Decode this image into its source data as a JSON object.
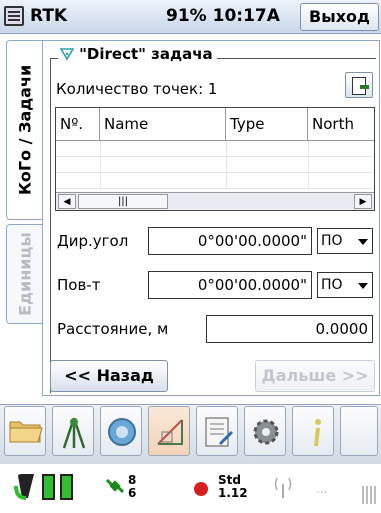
{
  "titlebar": {
    "app_title": "RTK",
    "status": "91% 10:17A",
    "exit_label": "Выход"
  },
  "tabs": [
    {
      "label": "КоГо / Задачи",
      "active": true
    },
    {
      "label": "Единицы",
      "active": false
    }
  ],
  "group": {
    "title": "\"Direct\" задача",
    "icon": "filter-icon"
  },
  "points": {
    "count_label": "Количество точек: 1",
    "export_icon": "export-icon"
  },
  "table": {
    "columns": [
      "Nº.",
      "Name",
      "Type",
      "North"
    ],
    "scroll_thumb": "|||"
  },
  "fields": {
    "direction": {
      "label": "Дир.угол",
      "value": "0°00'00.0000\"",
      "mode": "ПО"
    },
    "rotation": {
      "label": "Пов-т",
      "value": "0°00'00.0000\"",
      "mode": "ПО"
    },
    "distance": {
      "label": "Расстояние, м",
      "value": "0.0000"
    }
  },
  "nav": {
    "back_label": "<< Назад",
    "next_label": "Дальше >>"
  },
  "toolbar": {
    "items": [
      "folder-icon",
      "survey-icon",
      "lens-icon",
      "cogo-icon",
      "notes-icon",
      "settings-icon",
      "info-icon"
    ]
  },
  "status": {
    "sats_top": "8",
    "sats_bottom": "6",
    "solution_top": "Std",
    "solution_bottom": "1.12",
    "radio_dots": "..."
  },
  "colors": {
    "accent": "#8ea6c8",
    "battery_green": "#2fbf2f",
    "status_red": "#d81e1e"
  }
}
